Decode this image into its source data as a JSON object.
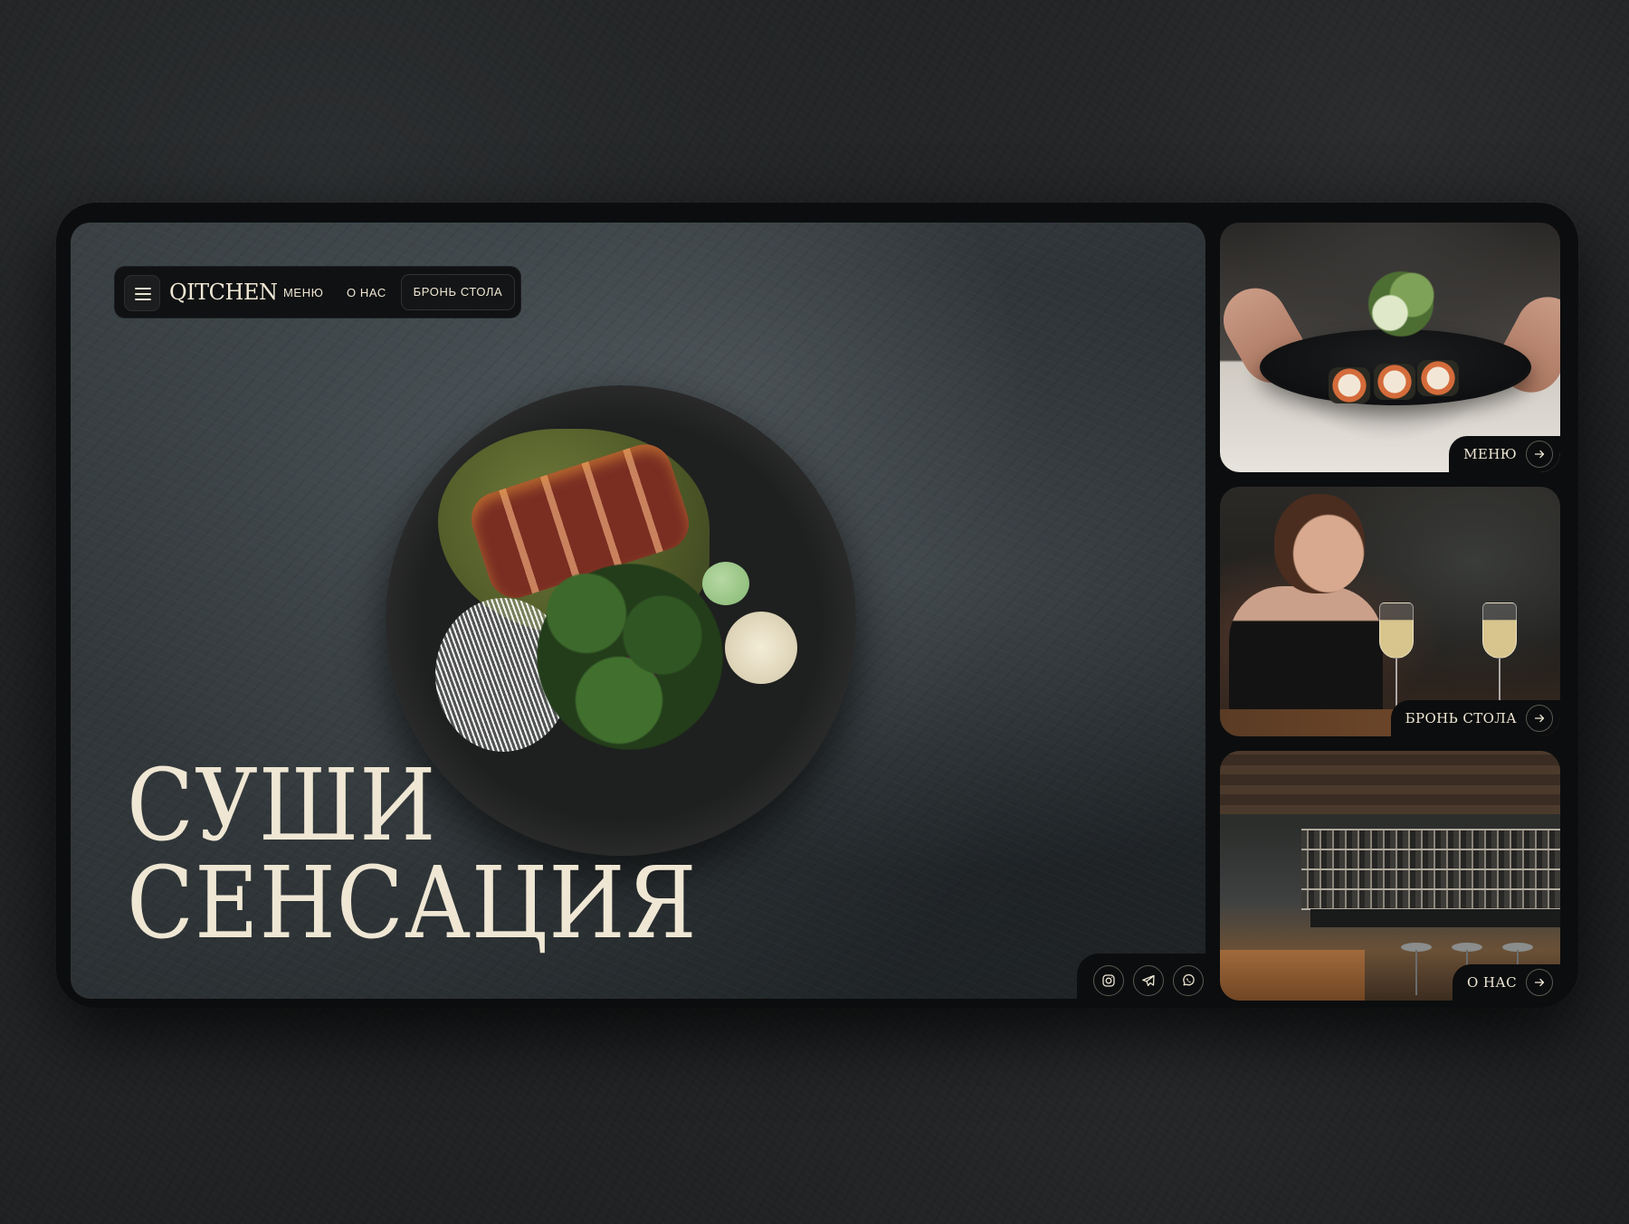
{
  "brand": {
    "logo": "QITCHEN"
  },
  "nav": {
    "links": [
      "МЕНЮ",
      "О НАС"
    ],
    "booking_label": "БРОНЬ СТОЛА"
  },
  "hero": {
    "title_line1": "СУШИ",
    "title_line2": "СЕНСАЦИЯ"
  },
  "social": [
    "instagram-icon",
    "telegram-icon",
    "whatsapp-icon"
  ],
  "cards": [
    {
      "label": "МЕНЮ"
    },
    {
      "label": "БРОНЬ СТОЛА"
    },
    {
      "label": "О НАС"
    }
  ],
  "colors": {
    "text": "#efe7d4",
    "panel": "#0c0d0e",
    "background": "#1a1b1c"
  }
}
